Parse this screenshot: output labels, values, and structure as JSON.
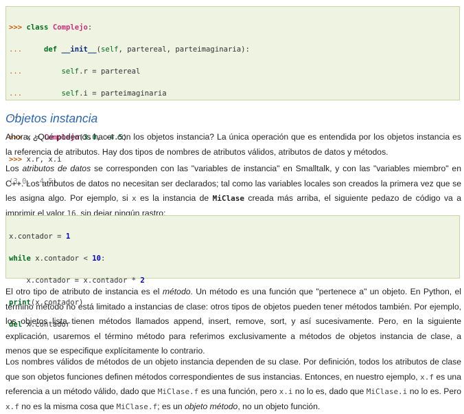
{
  "code_block_1": {
    "lines": [
      ">>> class Complejo:",
      "...     def __init__(self, partereal, parteimaginaria):",
      "...         self.r = partereal",
      "...         self.i = parteimaginaria",
      "...",
      ">>> x = Complejo(3.0, -4.5)",
      ">>> x.r, x.i",
      "(3.0, -4.5)"
    ]
  },
  "section_title": "Objetos instancia",
  "paragraph_1": "Ahora, ¿Qué podemos hacer con los objetos instancia? La única operación que es entendida por los objetos instancia es la referencia de atributos. Hay dos tipos de nombres de atributos válidos, atributos de datos y métodos.",
  "paragraph_2": {
    "t1": "Los ",
    "em1": "atributos de datos",
    "t2": " se corresponden con las \"variables de instancia\" en Smalltalk, y con las \"variables miembro\" en C++. Los atributos de datos no necesitan ser declarados; tal como las variables locales son creados la primera vez que se les asigna algo. Por ejemplo, si ",
    "c1": "x",
    "t3": " es la instancia de ",
    "c2": "MiClase",
    "t4": " creada más arriba, el siguiente pedazo de código va a imprimir el valor ",
    "c3": "16",
    "t5": ", sin dejar ningún rastro:"
  },
  "code_block_2": {
    "lines": [
      "x.contador = 1",
      "while x.contador < 10:",
      "    x.contador = x.contador * 2",
      "print(x.contador)",
      "del x.contador"
    ]
  },
  "paragraph_3": {
    "t1": "El otro tipo de atributo de instancia es el ",
    "em1": "método",
    "t2": ". Un método es una función que \"pertenece a\" un objeto. En Python, el término método no está limitado a instancias de clase: otros tipos de objetos pueden tener métodos también. Por ejemplo, los objetos lista tienen métodos llamados append, insert, remove, sort, y así sucesivamente. Pero, en la siguiente explicación, usaremos el término método para referimos exclusivamente a métodos de objetos instancia de clase, a menos que se especifique explícitamente lo contrario."
  },
  "paragraph_4": {
    "t1": "Los nombres válidos de métodos de un objeto instancia dependen de su clase. Por definición, todos los atributos de clase que son objetos funciones definen métodos correspondientes de sus instancias. Entonces, en nuestro ejemplo, ",
    "c1": "x.f",
    "t2": " es una referencia a un método válido, dado que ",
    "c2": "MiClase.f",
    "t3": " es una función, pero ",
    "c3": "x.i",
    "t4": " no lo es, dado que ",
    "c4": "MiClase.i",
    "t5": " no lo es. Pero ",
    "c5": "x.f",
    "t6": " no es la misma cosa que ",
    "c6": "MiClase.f",
    "t7": "; es un ",
    "em1": "objeto método",
    "t8": ", no un objeto función."
  },
  "colors": {
    "code_background": "#eef3e2",
    "code_border": "#c5d6a4",
    "heading": "#2a63b4",
    "prompt": "#c65d09",
    "keyword": "#007020"
  }
}
